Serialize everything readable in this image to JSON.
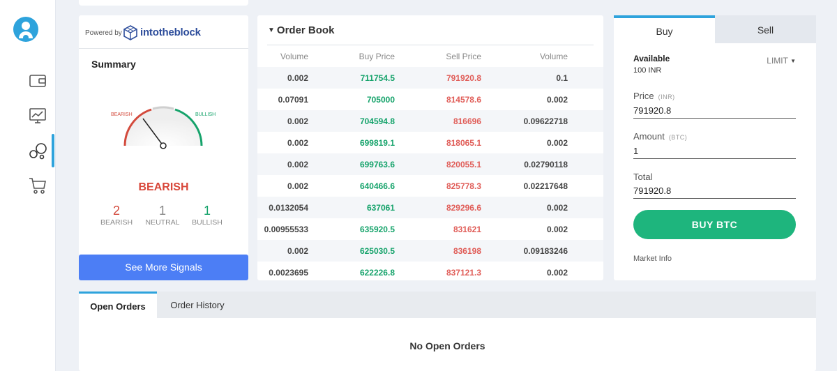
{
  "summary": {
    "powered_by": "Powered by",
    "brand": "intotheblock",
    "title": "Summary",
    "gauge_bearish": "BEARISH",
    "gauge_bullish": "BULLISH",
    "verdict": "BEARISH",
    "counts": [
      {
        "value": "2",
        "label": "BEARISH"
      },
      {
        "value": "1",
        "label": "NEUTRAL"
      },
      {
        "value": "1",
        "label": "BULLISH"
      }
    ],
    "see_more_label": "See More Signals"
  },
  "order_book": {
    "title": "Order Book",
    "headers": [
      "Volume",
      "Buy Price",
      "Sell Price",
      "Volume"
    ],
    "rows": [
      [
        "0.002",
        "711754.5",
        "791920.8",
        "0.1"
      ],
      [
        "0.07091",
        "705000",
        "814578.6",
        "0.002"
      ],
      [
        "0.002",
        "704594.8",
        "816696",
        "0.09622718"
      ],
      [
        "0.002",
        "699819.1",
        "818065.1",
        "0.002"
      ],
      [
        "0.002",
        "699763.6",
        "820055.1",
        "0.02790118"
      ],
      [
        "0.002",
        "640466.6",
        "825778.3",
        "0.02217648"
      ],
      [
        "0.0132054",
        "637061",
        "829296.6",
        "0.002"
      ],
      [
        "0.00955533",
        "635920.5",
        "831621",
        "0.002"
      ],
      [
        "0.002",
        "625030.5",
        "836198",
        "0.09183246"
      ],
      [
        "0.0023695",
        "622226.8",
        "837121.3",
        "0.002"
      ]
    ]
  },
  "trade": {
    "tab_buy": "Buy",
    "tab_sell": "Sell",
    "available_label": "Available",
    "available_value": "100 INR",
    "order_type": "LIMIT",
    "price_label": "Price",
    "price_unit": "(INR)",
    "price_value": "791920.8",
    "amount_label": "Amount",
    "amount_unit": "(BTC)",
    "amount_value": "1",
    "total_label": "Total",
    "total_value": "791920.8",
    "buy_button": "BUY BTC",
    "market_info": "Market Info"
  },
  "orders": {
    "tab_open": "Open Orders",
    "tab_history": "Order History",
    "empty_message": "No Open Orders"
  },
  "colors": {
    "accent": "#2ea3dc",
    "buy_green": "#16a36b",
    "sell_red": "#e05c57",
    "signals_blue": "#4c7ef5"
  }
}
